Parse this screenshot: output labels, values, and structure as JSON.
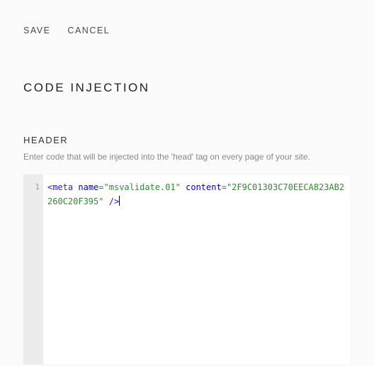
{
  "actions": {
    "save": "SAVE",
    "cancel": "CANCEL"
  },
  "page": {
    "title": "CODE INJECTION"
  },
  "section": {
    "label": "HEADER",
    "description": "Enter code that will be injected into the 'head' tag on every page of your site."
  },
  "editor": {
    "gutter": {
      "line1": "1"
    },
    "code_tokens": {
      "open_bracket": "<",
      "tag_name": "meta",
      "attr1_name": "name",
      "eq": "=",
      "attr1_value": "\"msvalidate.01\"",
      "attr2_name": "content",
      "attr2_value": "\"2F9C01303C70EECA823AB2260C20F395\"",
      "self_close": "/>"
    },
    "raw_code": "<meta name=\"msvalidate.01\" content=\"2F9C01303C70EECA823AB2260C20F395\" />"
  }
}
